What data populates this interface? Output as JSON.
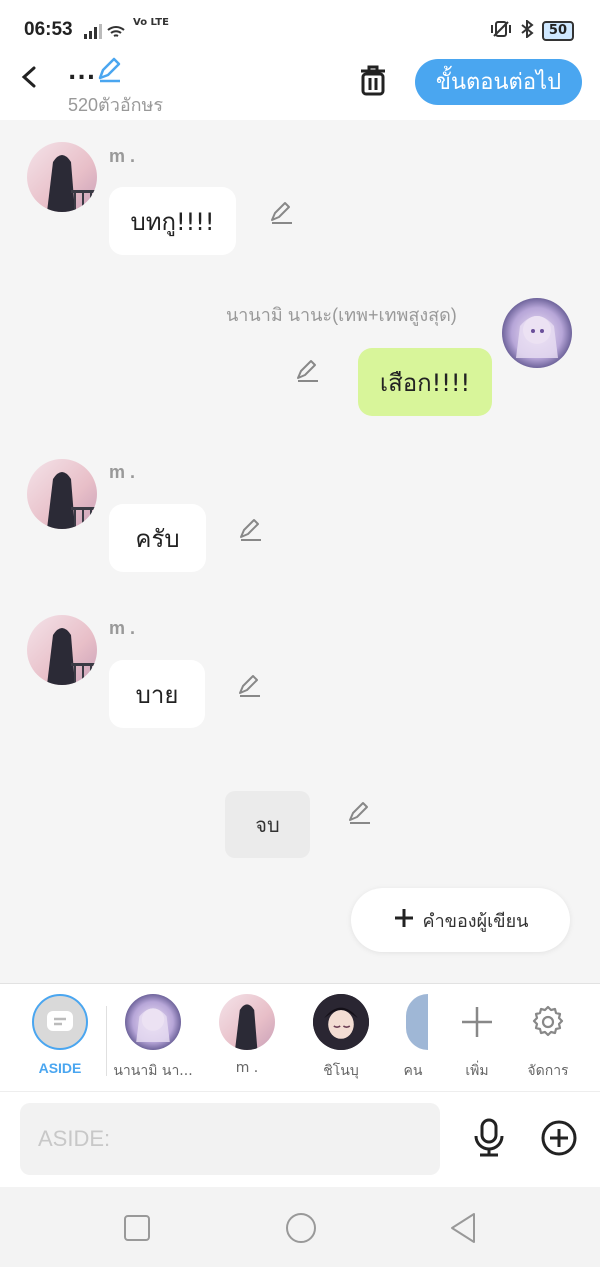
{
  "status": {
    "time": "06:53",
    "network": "Vo LTE",
    "battery": "50"
  },
  "header": {
    "title_dots": "...",
    "char_count": "520ตัวอักษร",
    "next_label": "ขั้นตอนต่อไป"
  },
  "messages": [
    {
      "speaker": "m .",
      "text": "บทกู!!!!"
    },
    {
      "speaker": "นานามิ นานะ(เทพ+เทพสูงสุด)",
      "text": "เสือก!!!!"
    },
    {
      "speaker": "m .",
      "text": "ครับ"
    },
    {
      "speaker": "m .",
      "text": "บาย"
    }
  ],
  "end_label": "จบ",
  "author_note_label": "คำของผู้เขียน",
  "characters": {
    "aside": "ASIDE",
    "c1": "นานามิ นา...",
    "c2": "m .",
    "c3": "ชิโนบุ",
    "c4": "คน",
    "add": "เพิ่ม",
    "manage": "จัดการ"
  },
  "input": {
    "placeholder": "ASIDE:"
  },
  "colors": {
    "accent": "#4aa6f0",
    "green_bubble": "#d8f59a"
  }
}
